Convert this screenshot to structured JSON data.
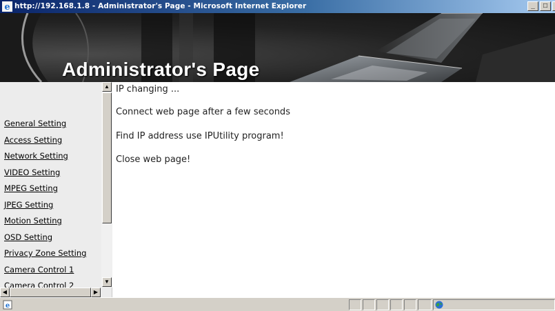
{
  "window": {
    "title": "http://192.168.1.8 - Administrator's Page - Microsoft Internet Explorer",
    "controls": {
      "minimize": "_",
      "maximize": "□",
      "close": "x"
    }
  },
  "banner": {
    "title": "Administrator's Page"
  },
  "sidebar": {
    "items": [
      {
        "label": "General Setting"
      },
      {
        "label": "Access Setting"
      },
      {
        "label": "Network Setting"
      },
      {
        "label": "VIDEO Setting"
      },
      {
        "label": "MPEG Setting"
      },
      {
        "label": "JPEG Setting"
      },
      {
        "label": "Motion Setting"
      },
      {
        "label": "OSD Setting"
      },
      {
        "label": "Privacy Zone Setting"
      },
      {
        "label": "Camera Control 1"
      },
      {
        "label": "Camera Control 2"
      }
    ]
  },
  "main": {
    "messages": [
      "IP changing ...",
      "Connect web page after a few seconds",
      "Find IP address use IPUtility program!",
      "Close web page!"
    ]
  },
  "icons": {
    "window": "ie-icon",
    "status": "ie-page-icon",
    "zone": "globe-icon"
  },
  "colors": {
    "titlebar_start": "#0a246a",
    "titlebar_end": "#a6caf0",
    "chrome": "#d4d0c8",
    "sidebar_bg": "#ececec"
  }
}
